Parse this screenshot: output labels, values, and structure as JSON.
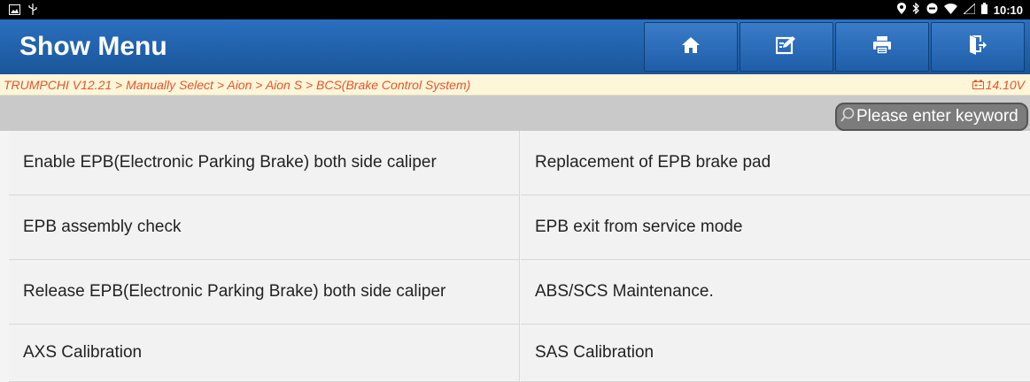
{
  "status_bar": {
    "time": "10:10",
    "left_icons": [
      "image-icon",
      "usb-icon"
    ],
    "right_icons": [
      "location-icon",
      "bluetooth-icon",
      "minus-circle-icon",
      "wifi-icon",
      "signal-icon",
      "battery-icon"
    ]
  },
  "header": {
    "title": "Show Menu",
    "buttons": [
      {
        "icon": "home-icon"
      },
      {
        "icon": "edit-icon"
      },
      {
        "icon": "print-icon"
      },
      {
        "icon": "exit-icon"
      }
    ],
    "color": "#1f5ea9"
  },
  "breadcrumb": {
    "path": "TRUMPCHI V12.21 > Manually Select > Aion > Aion S > BCS(Brake Control System)",
    "voltage": "14.10V",
    "color": "#e8542e"
  },
  "search": {
    "placeholder": "Please enter keyword"
  },
  "menu": {
    "items": [
      "Enable EPB(Electronic Parking Brake) both side caliper",
      "Replacement of EPB brake pad",
      "EPB assembly check",
      "EPB exit from service mode",
      "Release EPB(Electronic Parking Brake) both side caliper",
      "ABS/SCS Maintenance.",
      "AXS Calibration",
      "SAS Calibration"
    ]
  }
}
